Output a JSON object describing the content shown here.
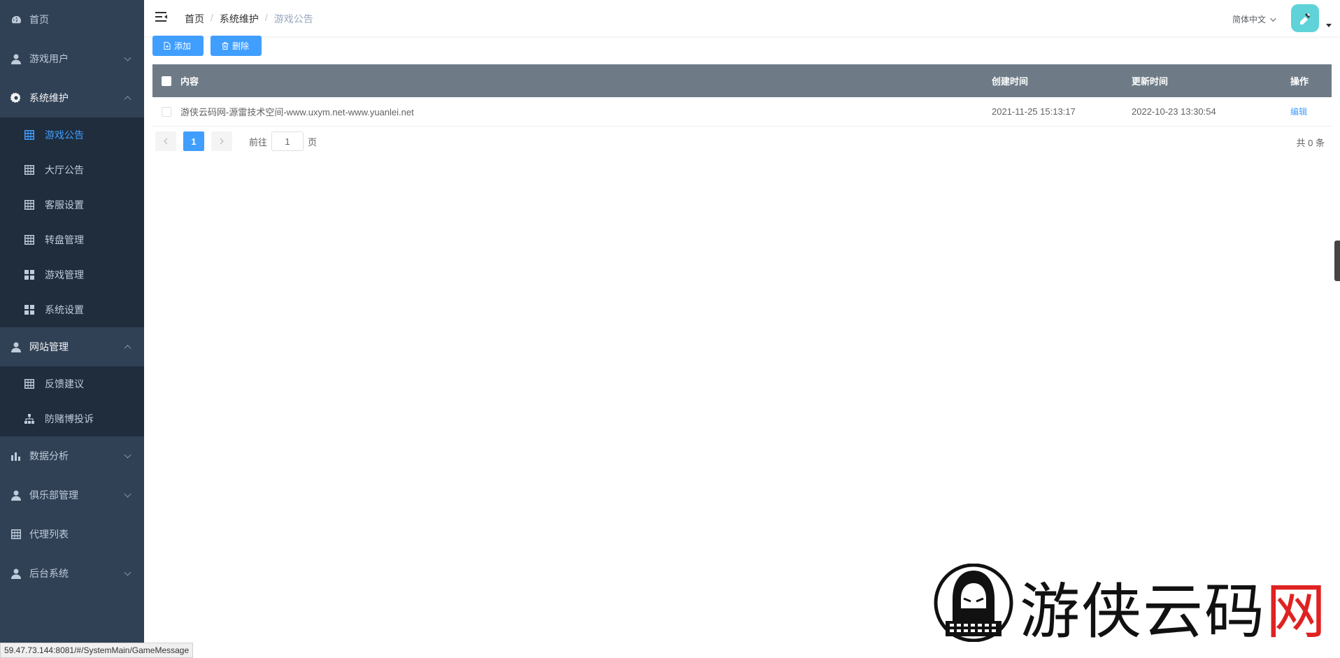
{
  "sidebar": {
    "items": [
      {
        "label": "首页",
        "icon": "dashboard-icon"
      },
      {
        "label": "游戏用户",
        "icon": "user-icon"
      },
      {
        "label": "系统维护",
        "icon": "gear-icon"
      },
      {
        "label": "网站管理",
        "icon": "user-icon"
      },
      {
        "label": "数据分析",
        "icon": "bar-chart-icon"
      },
      {
        "label": "俱乐部管理",
        "icon": "user-icon"
      },
      {
        "label": "代理列表",
        "icon": "grid-icon"
      },
      {
        "label": "后台系统",
        "icon": "user-icon"
      }
    ],
    "system_sub": [
      {
        "label": "游戏公告",
        "icon": "table-icon"
      },
      {
        "label": "大厅公告",
        "icon": "table-icon"
      },
      {
        "label": "客服设置",
        "icon": "table-icon"
      },
      {
        "label": "转盘管理",
        "icon": "table-icon"
      },
      {
        "label": "游戏管理",
        "icon": "apps-icon"
      },
      {
        "label": "系统设置",
        "icon": "apps-icon"
      }
    ],
    "site_sub": [
      {
        "label": "反馈建议",
        "icon": "table-icon"
      },
      {
        "label": "防赌博投诉",
        "icon": "tree-icon"
      }
    ]
  },
  "navbar": {
    "breadcrumb": [
      "首页",
      "系统维护",
      "游戏公告"
    ],
    "language": "简体中文"
  },
  "toolbar": {
    "add_label": "添加",
    "delete_label": "删除"
  },
  "table": {
    "headers": [
      "内容",
      "创建时间",
      "更新时间",
      "操作"
    ],
    "rows": [
      {
        "content": "游侠云码网-源雷技术空间-www.uxym.net-www.yuanlei.net",
        "created": "2021-11-25 15:13:17",
        "updated": "2022-10-23 13:30:54",
        "action": "编辑"
      }
    ]
  },
  "pagination": {
    "current_page": "1",
    "goto_prefix": "前往",
    "goto_value": "1",
    "goto_suffix": "页",
    "total": "共 0 条"
  },
  "watermark": {
    "text_main": "游侠云码",
    "text_last": "网"
  },
  "statusbar": {
    "url": "59.47.73.144:8081/#/SystemMain/GameMessage"
  },
  "colors": {
    "sidebar_bg": "#304156",
    "submenu_bg": "#1f2d3d",
    "accent": "#409eff",
    "table_header": "#6e7b87"
  }
}
